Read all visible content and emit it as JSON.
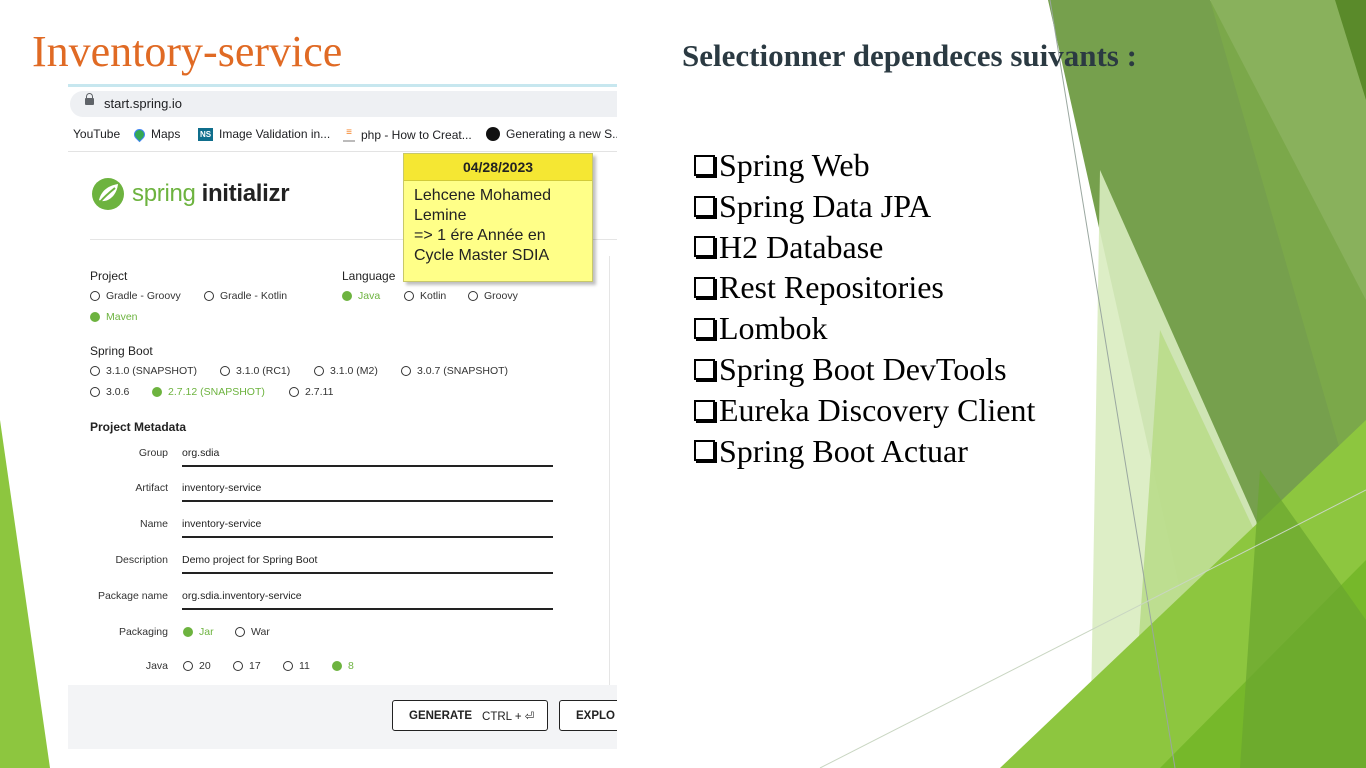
{
  "slide": {
    "title": "Inventory-service",
    "heading": "Selectionner dependeces suivants :",
    "dependencies": [
      "Spring Web",
      "Spring Data JPA",
      "H2 Database",
      "Rest Repositories",
      "Lombok",
      "Spring Boot DevTools",
      "Eureka Discovery Client",
      "Spring Boot Actuar"
    ],
    "colors": {
      "title": "#e06a24",
      "green_light": "#8dc63f",
      "green_dark": "#5f9a2c"
    }
  },
  "browser": {
    "url": "start.spring.io",
    "bookmarks": [
      {
        "label": "YouTube",
        "icon": "youtube-icon"
      },
      {
        "label": "Maps",
        "icon": "maps-pin-icon"
      },
      {
        "label": "Image Validation in...",
        "icon": "ns-icon"
      },
      {
        "label": "php - How to Creat...",
        "icon": "stackoverflow-icon"
      },
      {
        "label": "Generating a new S...",
        "icon": "github-icon"
      }
    ]
  },
  "note": {
    "date": "04/28/2023",
    "text": "Lehcene Mohamed\nLemine\n=> 1 ére Année en\nCycle Master SDIA"
  },
  "initializr": {
    "logo_spring": "spring",
    "logo_initializr": "initializr",
    "accent": "#6db33f",
    "project": {
      "label": "Project",
      "options": [
        "Gradle - Groovy",
        "Gradle - Kotlin",
        "Maven"
      ],
      "selected": "Maven"
    },
    "language": {
      "label": "Language",
      "options": [
        "Java",
        "Kotlin",
        "Groovy"
      ],
      "selected": "Java"
    },
    "spring_boot": {
      "label": "Spring Boot",
      "options": [
        "3.1.0 (SNAPSHOT)",
        "3.1.0 (RC1)",
        "3.1.0 (M2)",
        "3.0.7 (SNAPSHOT)",
        "3.0.6",
        "2.7.12 (SNAPSHOT)",
        "2.7.11"
      ],
      "selected": "2.7.12 (SNAPSHOT)"
    },
    "metadata": {
      "label": "Project Metadata",
      "group_label": "Group",
      "group": "org.sdia",
      "artifact_label": "Artifact",
      "artifact": "inventory-service",
      "name_label": "Name",
      "name": "inventory-service",
      "description_label": "Description",
      "description": "Demo project for Spring Boot",
      "package_label": "Package name",
      "package": "org.sdia.inventory-service",
      "packaging_label": "Packaging",
      "packaging_options": [
        "Jar",
        "War"
      ],
      "packaging_selected": "Jar",
      "java_label": "Java",
      "java_options": [
        "20",
        "17",
        "11",
        "8"
      ],
      "java_selected": "8"
    },
    "buttons": {
      "generate": "GENERATE",
      "generate_shortcut": "CTRL + ⏎",
      "explore": "EXPLO"
    }
  }
}
